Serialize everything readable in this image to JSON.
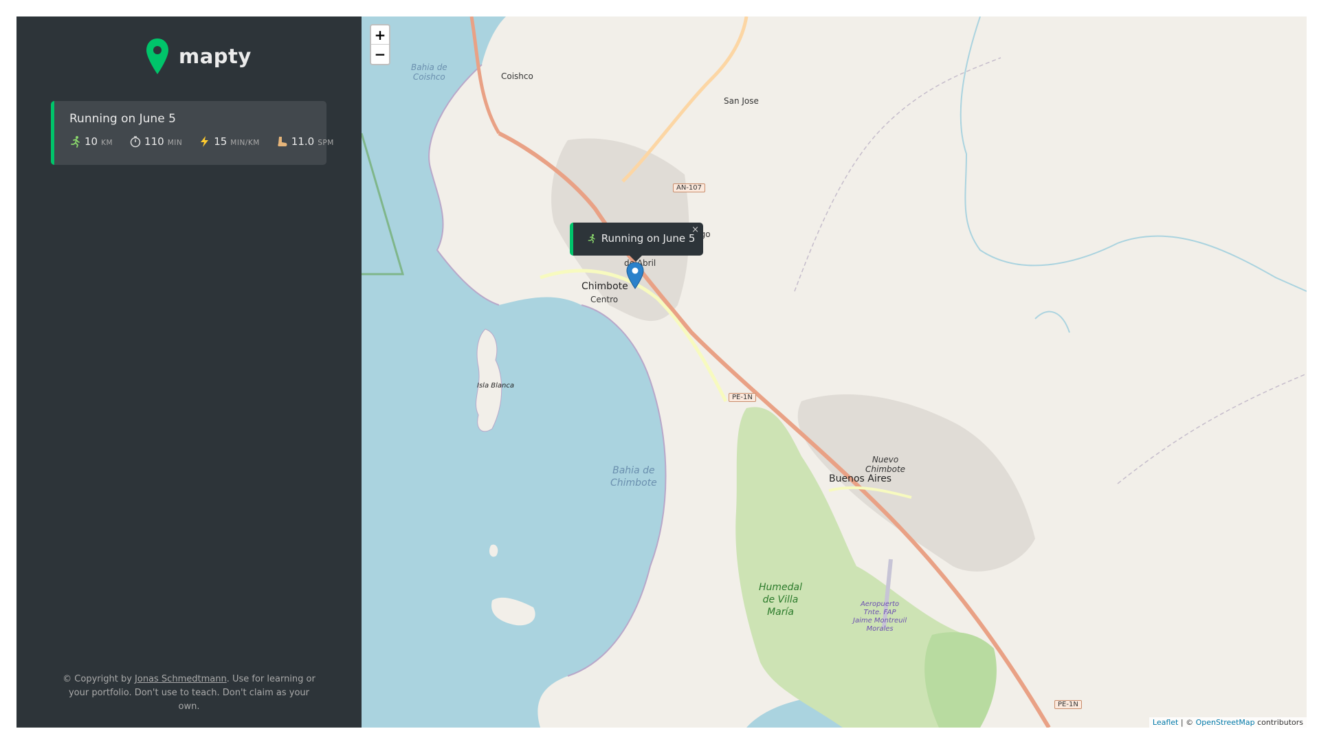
{
  "app": {
    "name": "mapty"
  },
  "workouts": [
    {
      "title": "Running on June 5",
      "type": "running",
      "color": "#00c46a",
      "details": [
        {
          "icon": "running-icon",
          "value": "10",
          "unit": "km"
        },
        {
          "icon": "stopwatch-icon",
          "value": "110",
          "unit": "min"
        },
        {
          "icon": "lightning-icon",
          "value": "15",
          "unit": "min/km"
        },
        {
          "icon": "footprint-icon",
          "value": "11.0",
          "unit": "spm"
        }
      ]
    }
  ],
  "copyright": {
    "prefix": "© Copyright by ",
    "author": "Jonas Schmedtmann",
    "suffix": ". Use for learning or your portfolio. Don't use to teach. Don't claim as your own."
  },
  "map": {
    "zoom_in": "+",
    "zoom_out": "−",
    "popup": {
      "text": "Running on June 5",
      "close": "×"
    },
    "labels": {
      "coishco": "Coishco",
      "bahia_coishco_1": "Bahia de",
      "bahia_coishco_2": "Coishco",
      "san_jose": "San Jose",
      "chimbote": "Chimbote",
      "centro": "Centro",
      "abril": "de Abril",
      "ngo": "ngo",
      "isla_blanca": "Isla Blanca",
      "bahia_chimbote_1": "Bahia de",
      "bahia_chimbote_2": "Chimbote",
      "nuevo_chimbote_1": "Nuevo",
      "nuevo_chimbote_2": "Chimbote",
      "buenos_aires": "Buenos Aires",
      "humedal_1": "Humedal",
      "humedal_2": "de Villa",
      "humedal_3": "María",
      "airport_1": "Aeropuerto",
      "airport_2": "Tnte. FAP",
      "airport_3": "Jaime Montreuil",
      "airport_4": "Morales"
    },
    "shields": {
      "an107": "AN-107",
      "pe1n_a": "PE-1N",
      "pe1n_b": "PE-1N"
    },
    "attribution": {
      "leaflet": "Leaflet",
      "separator": " | © ",
      "osm": "OpenStreetMap",
      "suffix": " contributors"
    }
  },
  "colors": {
    "accent_running": "#00c46a",
    "sidebar_bg": "#2d3439",
    "card_bg": "#42484d",
    "water": "#aad3df",
    "land": "#f2efe9"
  }
}
